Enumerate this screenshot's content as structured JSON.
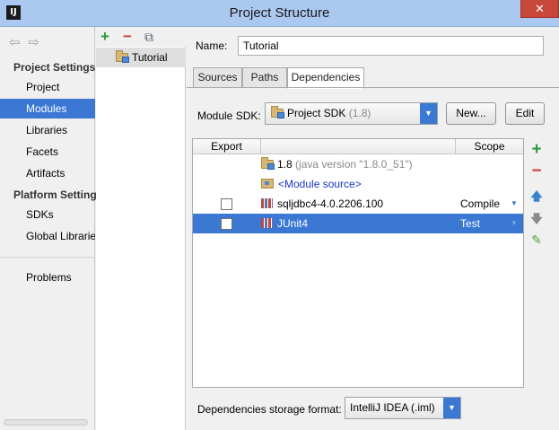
{
  "window": {
    "title": "Project Structure",
    "app_icon": "IJ",
    "close_glyph": "✕"
  },
  "nav": {
    "back_glyph": "⇦",
    "forward_glyph": "⇨",
    "section_project": "Project Settings",
    "project_items": [
      "Project",
      "Modules",
      "Libraries",
      "Facets",
      "Artifacts"
    ],
    "section_platform": "Platform Settings",
    "platform_items": [
      "SDKs",
      "Global Libraries"
    ],
    "problems": "Problems",
    "selected": "Modules"
  },
  "modules": {
    "add_glyph": "+",
    "remove_glyph": "−",
    "copy_glyph": "⧉",
    "items": [
      "Tutorial"
    ]
  },
  "form": {
    "name_label": "Name:",
    "name_value": "Tutorial",
    "tabs": [
      "Sources",
      "Paths",
      "Dependencies"
    ],
    "active_tab": "Dependencies",
    "sdk_label": "Module SDK:",
    "sdk_value": "Project SDK",
    "sdk_version": "(1.8)",
    "combo_arrow": "▼",
    "new_button": "New...",
    "edit_button": "Edit"
  },
  "dependencies": {
    "columns": {
      "export": "Export",
      "scope": "Scope"
    },
    "rows": [
      {
        "name": "1.8",
        "detail": "(java version \"1.8.0_51\")",
        "type": "sdk",
        "scope": "",
        "checkbox": false
      },
      {
        "name": "<Module source>",
        "detail": "",
        "type": "source",
        "scope": "",
        "checkbox": false
      },
      {
        "name": "sqljdbc4-4.0.2206.100",
        "detail": "",
        "type": "library",
        "scope": "Compile",
        "checkbox": true
      },
      {
        "name": "JUnit4",
        "detail": "",
        "type": "library",
        "scope": "Test",
        "checkbox": true,
        "selected": true
      }
    ],
    "scope_arrow": "▼",
    "tools": {
      "add": "+",
      "remove": "−",
      "up": "🡅",
      "down": "🡇",
      "edit": "✎"
    }
  },
  "storage": {
    "label": "Dependencies storage format:",
    "value": "IntelliJ IDEA (.iml)"
  },
  "colors": {
    "selection": "#3a78d4",
    "add": "#2d9a3a",
    "remove": "#cc3b3b",
    "link": "#1a35c8"
  }
}
